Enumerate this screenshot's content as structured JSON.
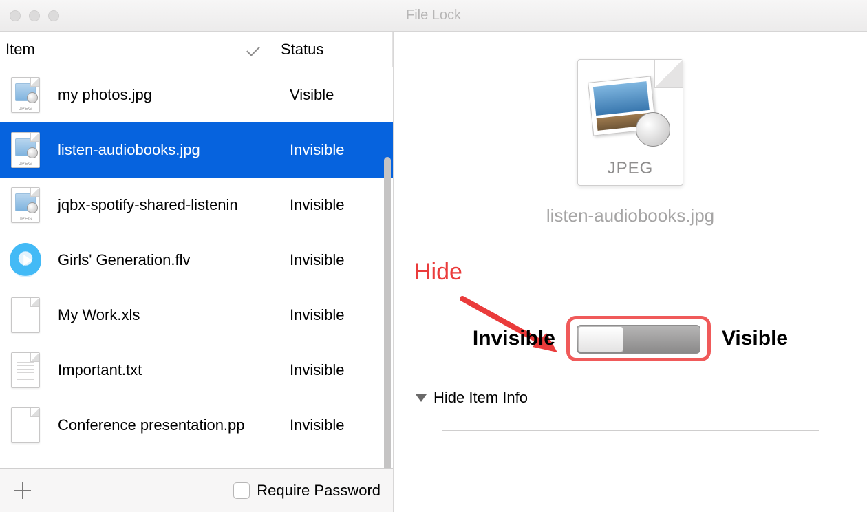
{
  "window": {
    "title": "File Lock"
  },
  "columns": {
    "item": "Item",
    "status": "Status"
  },
  "files": [
    {
      "name": "my photos.jpg",
      "status": "Visible",
      "icon": "jpeg",
      "selected": false
    },
    {
      "name": "listen-audiobooks.jpg",
      "status": "Invisible",
      "icon": "jpeg",
      "selected": true
    },
    {
      "name": "jqbx-spotify-shared-listenin",
      "status": "Invisible",
      "icon": "jpeg",
      "selected": false
    },
    {
      "name": "Girls' Generation.flv",
      "status": "Invisible",
      "icon": "video",
      "selected": false
    },
    {
      "name": "My Work.xls",
      "status": "Invisible",
      "icon": "blank",
      "selected": false
    },
    {
      "name": "Important.txt",
      "status": "Invisible",
      "icon": "text",
      "selected": false
    },
    {
      "name": "Conference presentation.pp",
      "status": "Invisible",
      "icon": "blank",
      "selected": false
    }
  ],
  "bottom": {
    "require_password": "Require Password"
  },
  "preview": {
    "type_label": "JPEG",
    "filename": "listen-audiobooks.jpg",
    "left_label": "Invisible",
    "right_label": "Visible",
    "hide_item_info": "Hide Item Info"
  },
  "annotation": {
    "hide": "Hide"
  }
}
